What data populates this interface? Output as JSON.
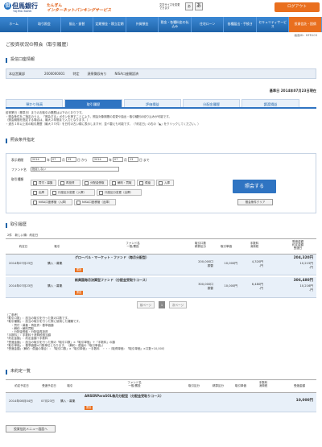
{
  "header": {
    "logo_mark": "但",
    "bank_name": "但馬銀行",
    "bank_name_en": "TAJIMA BANK",
    "service_line1": "たんぎん",
    "service_line2": "インターネットバンキングサービス",
    "font_size_label": "文字サイズを変更できます",
    "font_size_small": "あ",
    "font_size_large": "あ",
    "logout": "ログアウト"
  },
  "nav": [
    "ホーム",
    "取引照会",
    "振込・振替",
    "定期預金・積立定期",
    "外貨預金",
    "税金・各種料金の払込み",
    "住宅ローン",
    "各種届出・手続き",
    "セキュリティサービス",
    "投資信託・国債"
  ],
  "screen_id": "画面ID：BFR103",
  "page_title": "ご投資状況の照会（取引履歴）",
  "account_section": "投信口座情報",
  "account": {
    "branch": "本店営業部",
    "number": "2000000001",
    "type": "特定",
    "withholding": "源泉徴収有り",
    "nisa": "NISA口座開設済"
  },
  "base_date": "基準日 2014年07月23日現在",
  "tabs": [
    "預かり残高",
    "取引履歴",
    "評価損益",
    "分配金履歴",
    "譲渡損益"
  ],
  "notes": [
    "前営業日（基準日）までのお取引の履歴は以下のとおりです。",
    "・照会条件をご指定のうえ、「照会する」ボタンを押すことにより、照会対象期間の変更や抽出・取引種別の絞り込みが可能です。",
    "（照会期間を指定する場合は、最大２年間まで入力となります。）",
    "・過去１年以上前の取引履歴（最大３０件）を日付の古い順に表示しますが、並べ替えも可能です。（「約定日」の右の「▲」をクリックしてください。）"
  ],
  "cond_section": "照会条件指定",
  "cond": {
    "period_label": "表示期間",
    "y1": "2014",
    "m1": "07",
    "d1": "23",
    "y2": "2014",
    "m2": "07",
    "d2": "23",
    "year_unit": "年",
    "month_unit": "月",
    "day_unit": "日",
    "from_suffix": "から",
    "to_suffix": "まで",
    "fund_label": "ファンド名",
    "fund_value": "指定しない",
    "kind_label": "取引種類",
    "kinds": [
      "買付・募集",
      "再投資",
      "分配金受取",
      "解約・買取",
      "償還",
      "入庫",
      "出庫",
      "口座区分変更（入庫）",
      "口座区分変更（出庫）",
      "NISA口座移管（入庫）",
      "NISA口座移管（出庫）"
    ],
    "inquiry": "照会する",
    "clear": "照会条件クリア"
  },
  "history_section": "取引履歴",
  "count": "2件　新しい順：約定日",
  "table_headers": {
    "date": "約定日",
    "kind": "取引",
    "fund": "ファンド名\n一般/累投",
    "qty": "取引口数\n精算区分",
    "price": "取引単価",
    "fee": "手数料\n消費税",
    "amount": "受渡金額\n約定金額\n受渡日"
  },
  "rows": [
    {
      "date": "2014年07月23日",
      "kind": "購入・募集",
      "fund": "グローバル・マーケット・ファンド（毎月分配型）",
      "tag": "累投",
      "qty": "200,000口",
      "settle": "振替",
      "price": "10,000円",
      "fee": "4,320円",
      "tax": "-円",
      "amount": "204,320円",
      "contract": "10,215円",
      "deliv": "-円"
    },
    {
      "date": "2014年07月23日",
      "kind": "購入・募集",
      "fund": "新興国毎月決算型ファンド（分配金受取りコース）",
      "tag": "累投",
      "qty": "300,000口",
      "settle": "振替",
      "price": "10,000円",
      "fee": "6,480円",
      "tax": "-円",
      "amount": "306,480円",
      "contract": "10,216円",
      "deliv": "-円"
    }
  ],
  "pager": {
    "prev": "前ページ",
    "page": "1",
    "next": "次ページ"
  },
  "refs": [
    "（ご参考）",
    "「取引口数」：該当の取引を行った数の口数です。",
    "「取引種類」：該当の取引を行った際に使用した種類です。",
    "　　・買付・募集・再投資・基準価額",
    "　　・解約・解約買取",
    "　　・分配金受取・分配金再投資",
    "「手数料」：手数料＋消費税相当額",
    "「約定金額」：約定金額＋手数料",
    "「受渡金額」：該当の取引を行った際の「取引口数」×「取引単価」＋「手数料」の額",
    "「取引単価」：基準価額×口数単位となります。（解約・償還の「取引単価」）",
    "「受渡金額」（解約・償還の場合）：「取引口数」×「取引単価」－手数料　・・・（取得単価：「取引単価」×口数÷10,000）"
  ],
  "pending_section": "未約定一覧",
  "pending_headers": {
    "date": "約定予定日",
    "deliv": "受渡予定日",
    "kind": "取引",
    "fund": "ファンド名\n一般/累投",
    "qty": "取引区分",
    "settle": "精算区分",
    "price": "取引単価",
    "fee": "手数料\n消費税",
    "amount": "受渡金額"
  },
  "pending": {
    "date": "2014年08月04日",
    "deliv": "07月23日",
    "kind": "購入・募集",
    "fund": "ANSERParaSOL毎月分配型（分配金受取りコース）",
    "tag": "累投",
    "price": "",
    "amount": "10,000円"
  },
  "back": "投資信託メニュー画面へ"
}
